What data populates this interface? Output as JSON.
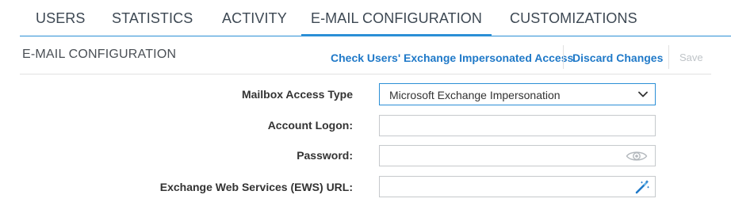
{
  "tabs": [
    {
      "label": "USERS",
      "active": false
    },
    {
      "label": "STATISTICS",
      "active": false
    },
    {
      "label": "ACTIVITY",
      "active": false
    },
    {
      "label": "E-MAIL CONFIGURATION",
      "active": true
    },
    {
      "label": "CUSTOMIZATIONS",
      "active": false
    }
  ],
  "section": {
    "title": "E-MAIL CONFIGURATION",
    "actions": {
      "check_label": "Check Users' Exchange Impersonated Access",
      "discard_label": "Discard Changes",
      "save_label": "Save",
      "save_enabled": false
    }
  },
  "form": {
    "mailbox_access_type": {
      "label": "Mailbox Access Type",
      "selected": "Microsoft Exchange Impersonation"
    },
    "account_logon": {
      "label": "Account Logon:",
      "value": ""
    },
    "password": {
      "label": "Password:",
      "value": "",
      "icon": "eye-icon"
    },
    "ews_url": {
      "label": "Exchange Web Services (EWS) URL:",
      "value": "",
      "icon": "magic-wand-icon"
    }
  },
  "colors": {
    "accent": "#2b8fd6",
    "link": "#1f79c8",
    "disabled": "#bfc4c8"
  }
}
